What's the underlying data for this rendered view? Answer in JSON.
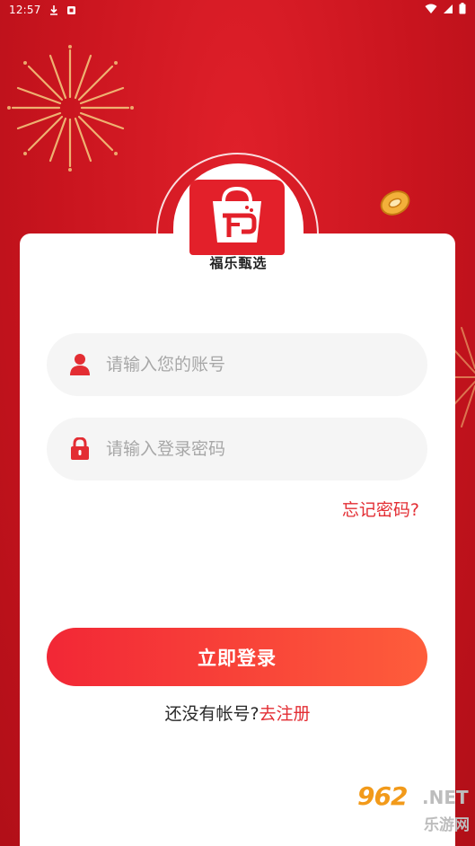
{
  "status_bar": {
    "time": "12:57",
    "left_icons": [
      "download-icon",
      "notification-icon"
    ],
    "right_icons": [
      "wifi-icon",
      "signal-icon",
      "battery-icon"
    ]
  },
  "logo": {
    "app_name": "福乐甄选",
    "icon": "shopping-bag-logo-icon",
    "brand_color": "#e3202a"
  },
  "form": {
    "account": {
      "placeholder": "请输入您的账号",
      "value": "",
      "icon": "user-icon"
    },
    "password": {
      "placeholder": "请输入登录密码",
      "value": "",
      "icon": "lock-icon"
    },
    "forgot_label": "忘记密码?",
    "login_label": "立即登录",
    "register_prefix": "还没有帐号?",
    "register_link": "去注册"
  },
  "watermark": {
    "number": "962",
    "domain": ".NET",
    "site_name": "乐游网"
  },
  "colors": {
    "background": "#c8141e",
    "accent": "#e32d33",
    "button_start": "#f22736",
    "button_end": "#fe5d3b"
  }
}
